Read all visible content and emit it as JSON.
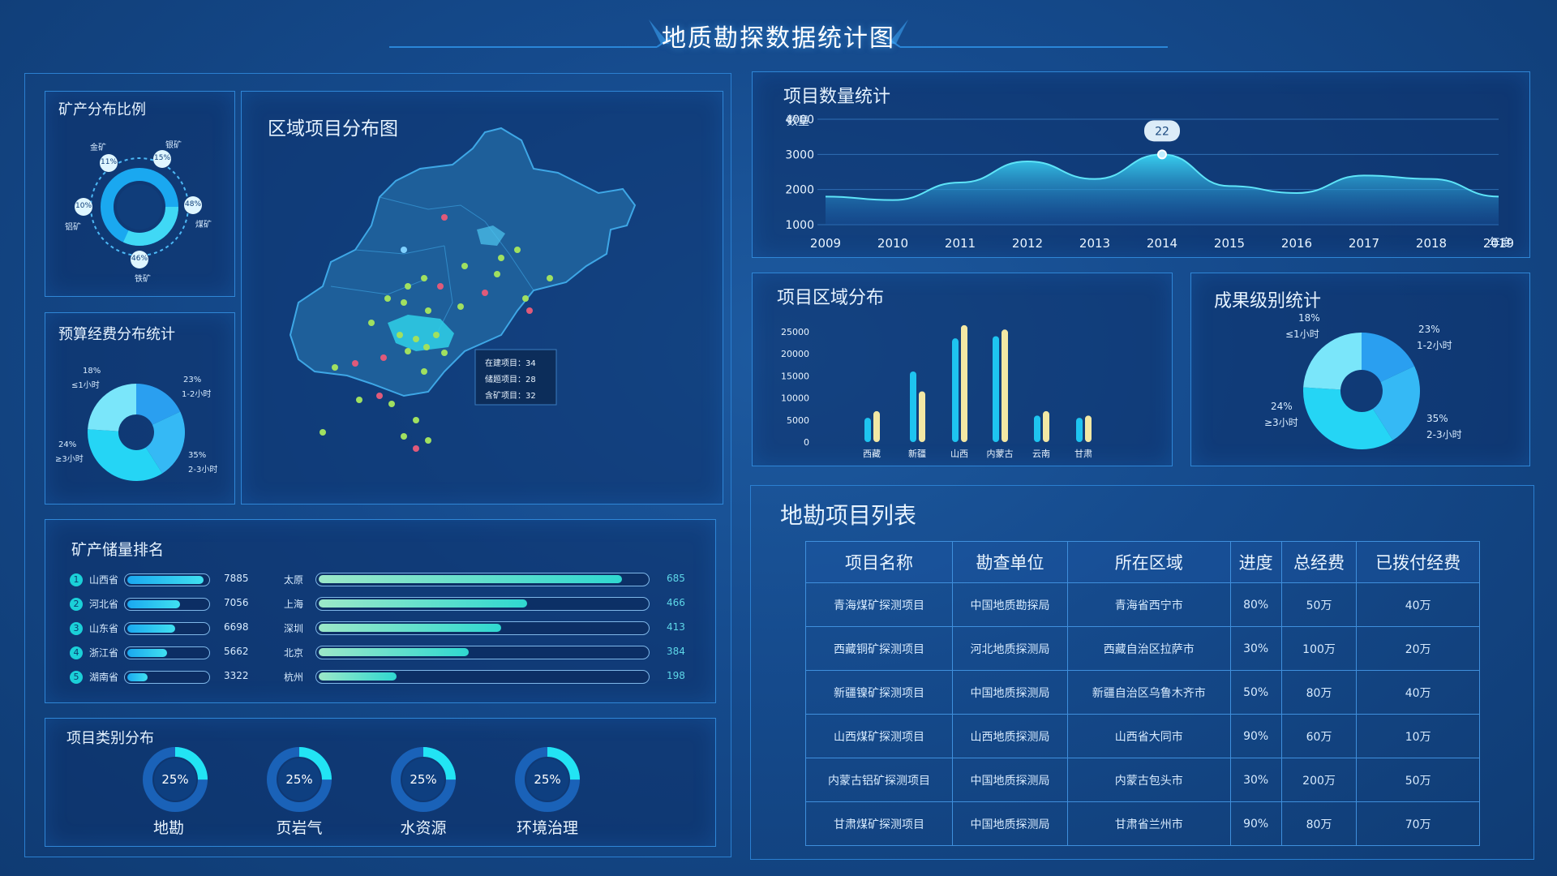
{
  "header": {
    "title": "地质勘探数据统计图"
  },
  "mineral_ratio": {
    "title": "矿产分布比例",
    "items": [
      {
        "name": "金矿",
        "pct": "11%"
      },
      {
        "name": "银矿",
        "pct": "15%"
      },
      {
        "name": "煤矿",
        "pct": "48%"
      },
      {
        "name": "铁矿",
        "pct": "46%"
      },
      {
        "name": "铝矿",
        "pct": "10%"
      }
    ]
  },
  "budget": {
    "title": "预算经费分布统计",
    "labels": [
      {
        "pct": "18%",
        "name": "≤1小时"
      },
      {
        "pct": "23%",
        "name": "1-2小时"
      },
      {
        "pct": "35%",
        "name": "2-3小时"
      },
      {
        "pct": "24%",
        "name": "≥3小时"
      }
    ]
  },
  "map": {
    "title": "区域项目分布图",
    "tooltip": [
      "在建项目：34",
      "储题项目：28",
      "含矿项目：32"
    ]
  },
  "reserve_rank": {
    "title": "矿产储量排名",
    "provinces": [
      {
        "rank": "1",
        "name": "山西省",
        "value": "7885",
        "frac": 0.96
      },
      {
        "rank": "2",
        "name": "河北省",
        "value": "7056",
        "frac": 0.66
      },
      {
        "rank": "3",
        "name": "山东省",
        "value": "6698",
        "frac": 0.6
      },
      {
        "rank": "4",
        "name": "浙江省",
        "value": "5662",
        "frac": 0.5
      },
      {
        "rank": "5",
        "name": "湖南省",
        "value": "3322",
        "frac": 0.25
      }
    ],
    "cities": [
      {
        "name": "太原",
        "value": "685",
        "frac": 0.93
      },
      {
        "name": "上海",
        "value": "466",
        "frac": 0.64
      },
      {
        "name": "深圳",
        "value": "413",
        "frac": 0.56
      },
      {
        "name": "北京",
        "value": "384",
        "frac": 0.46
      },
      {
        "name": "杭州",
        "value": "198",
        "frac": 0.24
      }
    ]
  },
  "category": {
    "title": "项目类别分布",
    "items": [
      {
        "name": "地勘",
        "pct": "25%"
      },
      {
        "name": "页岩气",
        "pct": "25%"
      },
      {
        "name": "水资源",
        "pct": "25%"
      },
      {
        "name": "环境治理",
        "pct": "25%"
      }
    ]
  },
  "project_count": {
    "title": "项目数量统计",
    "ylabel": "数量",
    "xunit": "年度",
    "highlight": "22"
  },
  "region_dist": {
    "title": "项目区域分布"
  },
  "result_level": {
    "title": "成果级别统计",
    "labels": [
      {
        "pct": "18%",
        "name": "≤1小时"
      },
      {
        "pct": "23%",
        "name": "1-2小时"
      },
      {
        "pct": "35%",
        "name": "2-3小时"
      },
      {
        "pct": "24%",
        "name": "≥3小时"
      }
    ]
  },
  "project_list": {
    "title": "地勘项目列表",
    "headers": [
      "项目名称",
      "勘查单位",
      "所在区域",
      "进度",
      "总经费",
      "已拨付经费"
    ],
    "rows": [
      [
        "青海煤矿探测项目",
        "中国地质勘探局",
        "青海省西宁市",
        "80%",
        "50万",
        "40万"
      ],
      [
        "西藏铜矿探测项目",
        "河北地质探测局",
        "西藏自治区拉萨市",
        "30%",
        "100万",
        "20万"
      ],
      [
        "新疆镍矿探测项目",
        "中国地质探测局",
        "新疆自治区乌鲁木齐市",
        "50%",
        "80万",
        "40万"
      ],
      [
        "山西煤矿探测项目",
        "山西地质探测局",
        "山西省大同市",
        "90%",
        "60万",
        "10万"
      ],
      [
        "内蒙古铝矿探测项目",
        "中国地质探测局",
        "内蒙古包头市",
        "30%",
        "200万",
        "50万"
      ],
      [
        "甘肃煤矿探测项目",
        "中国地质探测局",
        "甘肃省兰州市",
        "90%",
        "80万",
        "70万"
      ]
    ]
  },
  "colors": {
    "accent": "#1ee0f0",
    "yellow": "#f3e8a4",
    "blue": "#1aa8f0",
    "frame": "#2f86d6"
  },
  "chart_data": [
    {
      "type": "area",
      "title": "项目数量统计",
      "xlabel": "年度",
      "ylabel": "数量",
      "x": [
        "2009",
        "2010",
        "2011",
        "2012",
        "2013",
        "2014",
        "2015",
        "2016",
        "2017",
        "2018",
        "2019"
      ],
      "yticks": [
        1000,
        2000,
        3000,
        4000
      ],
      "ylim": [
        1000,
        4000
      ],
      "values": [
        1800,
        1700,
        2200,
        2800,
        2300,
        3000,
        2100,
        1900,
        2400,
        2300,
        1800
      ],
      "annotation": "22",
      "grid": true
    },
    {
      "type": "bar",
      "title": "项目区域分布",
      "categories": [
        "西藏",
        "新疆",
        "山西",
        "内蒙古",
        "云南",
        "甘肃"
      ],
      "ylim": [
        0,
        25000
      ],
      "yticks": [
        0,
        5000,
        10000,
        15000,
        20000,
        25000
      ],
      "series": [
        {
          "values": [
            5500,
            16000,
            23500,
            24000,
            6000,
            5500
          ]
        },
        {
          "values": [
            7000,
            11500,
            26500,
            25500,
            7000,
            6000
          ]
        }
      ]
    },
    {
      "type": "pie",
      "title": "成果级别统计",
      "categories": [
        "≤1小时",
        "1-2小时",
        "2-3小时",
        "≥3小时"
      ],
      "values": [
        18,
        23,
        35,
        24
      ]
    }
  ]
}
